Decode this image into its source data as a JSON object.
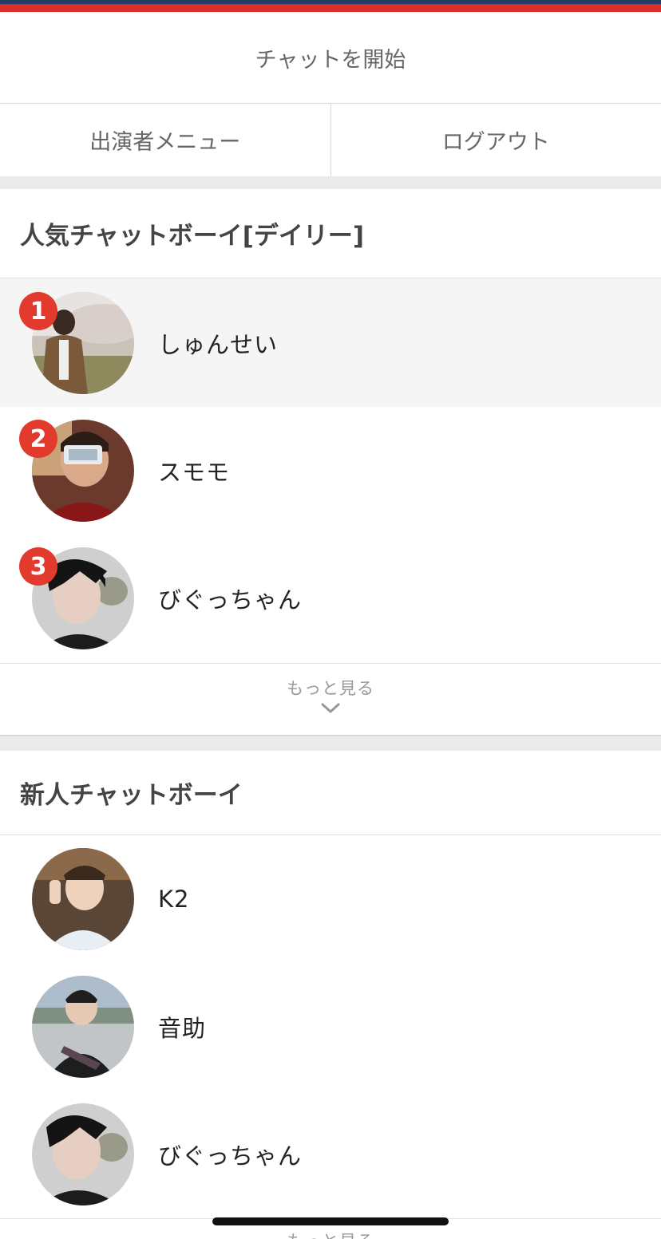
{
  "header": {
    "start_chat": "チャットを開始"
  },
  "menu": {
    "performer_menu": "出演者メニュー",
    "logout": "ログアウト"
  },
  "popular": {
    "title": "人気チャットボーイ[デイリー]",
    "items": [
      {
        "rank": "1",
        "name": "しゅんせい",
        "avatar": "photo-avatar"
      },
      {
        "rank": "2",
        "name": "スモモ",
        "avatar": "photo-avatar"
      },
      {
        "rank": "3",
        "name": "びぐっちゃん",
        "avatar": "photo-avatar"
      }
    ],
    "more_label": "もっと見る"
  },
  "newcomers": {
    "title": "新人チャットボーイ",
    "items": [
      {
        "name": "K2",
        "avatar": "photo-avatar"
      },
      {
        "name": "音助",
        "avatar": "photo-avatar"
      },
      {
        "name": "びぐっちゃん",
        "avatar": "photo-avatar"
      }
    ],
    "more_label": "もっと見る"
  },
  "colors": {
    "accent_red": "#d82e29",
    "navy": "#263a66",
    "rank_badge": "#e33a2e"
  },
  "icons": {
    "more": "chevron-down-icon"
  }
}
